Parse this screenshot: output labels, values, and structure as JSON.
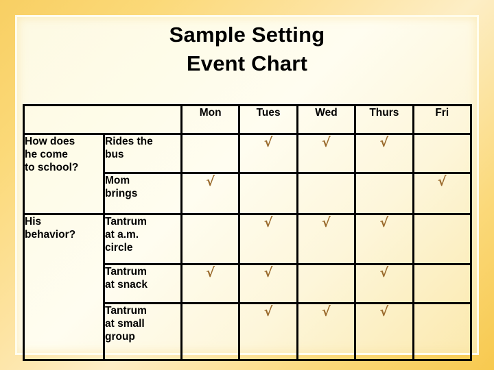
{
  "slide": {
    "title_line1": "Sample Setting",
    "title_line2": "Event Chart"
  },
  "table": {
    "corner_label": "",
    "day_headers": [
      "Mon",
      "Tues",
      "Wed",
      "Thurs",
      "Fri"
    ],
    "check_symbol": "√",
    "check_color": "#9a6a2c",
    "groups": [
      {
        "question": "How does\nhe come\nto school?",
        "rows": [
          {
            "activity": "Rides the\nbus",
            "marks": [
              "",
              "√",
              "√",
              "√",
              ""
            ]
          },
          {
            "activity": "Mom\nbrings",
            "marks": [
              "√",
              "",
              "",
              "",
              "√"
            ]
          }
        ]
      },
      {
        "question": "His\nbehavior?",
        "rows": [
          {
            "activity": "Tantrum\nat a.m.\ncircle",
            "marks": [
              "",
              "√",
              "√",
              "√",
              ""
            ]
          },
          {
            "activity": "Tantrum\nat snack",
            "marks": [
              "√",
              "√",
              "",
              "√",
              ""
            ]
          },
          {
            "activity": "Tantrum\nat small\ngroup",
            "marks": [
              "",
              "√",
              "√",
              "√",
              ""
            ]
          }
        ]
      }
    ]
  }
}
